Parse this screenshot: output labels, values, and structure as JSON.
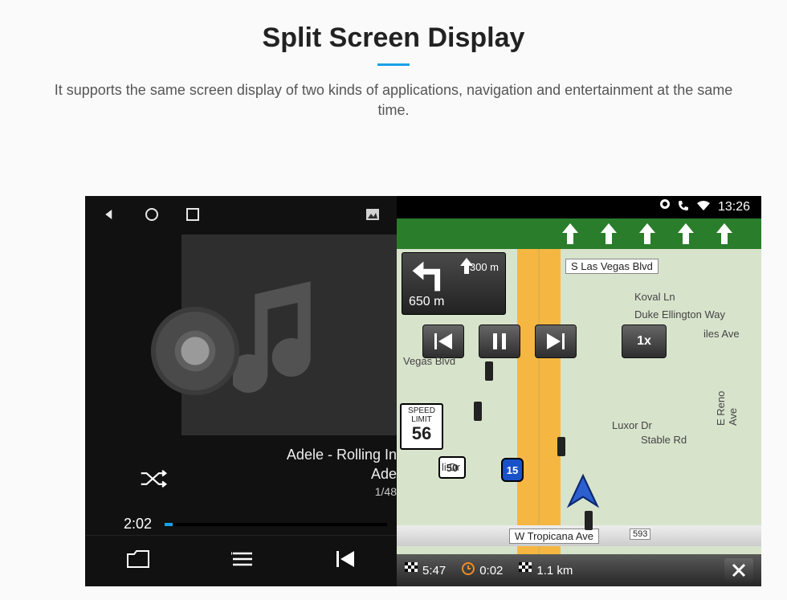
{
  "page": {
    "title": "Split Screen Display",
    "subtitle": "It supports the same screen display of two kinds of applications, navigation and entertainment at the same time."
  },
  "statusbar": {
    "time": "13:26"
  },
  "player": {
    "track_title": "Adele - Rolling In",
    "track_artist": "Ade",
    "track_count": "1/48",
    "elapsed": "2:02"
  },
  "nav": {
    "lanes_count": 5,
    "turn": {
      "next_distance": "300 m",
      "total_distance": "650 m"
    },
    "speed_button": "1x",
    "speed_limit_label": "SPEED LIMIT",
    "speed_limit_value": "56",
    "interstate": "15",
    "us_route": "50",
    "streets": {
      "s_las_vegas": "S Las Vegas Blvd",
      "koval": "Koval Ln",
      "duke": "Duke Ellington Way",
      "vegas_blvd_short": "Vegas Blvd",
      "luxor": "Luxor Dr",
      "stable": "Stable Rd",
      "reno": "E Reno Ave",
      "tropicana": "W Tropicana Ave",
      "tropicana_num": "593",
      "ali": "li Dr",
      "iles": "iles Ave"
    },
    "bottom": {
      "eta": "5:47",
      "duration": "0:02",
      "remaining": "1.1 km"
    }
  },
  "icons": {
    "back": "back-icon",
    "home": "home-icon",
    "recent": "recent-icon",
    "picture": "picture-icon",
    "location": "location-icon",
    "phone": "phone-icon",
    "wifi": "wifi-icon",
    "music_note": "music-note-icon",
    "shuffle": "shuffle-icon",
    "folder": "folder-icon",
    "list": "list-icon",
    "prev": "previous-icon",
    "pause": "pause-icon",
    "next": "next-icon",
    "close": "close-icon",
    "flag": "flag-icon",
    "clock": "clock-icon"
  }
}
